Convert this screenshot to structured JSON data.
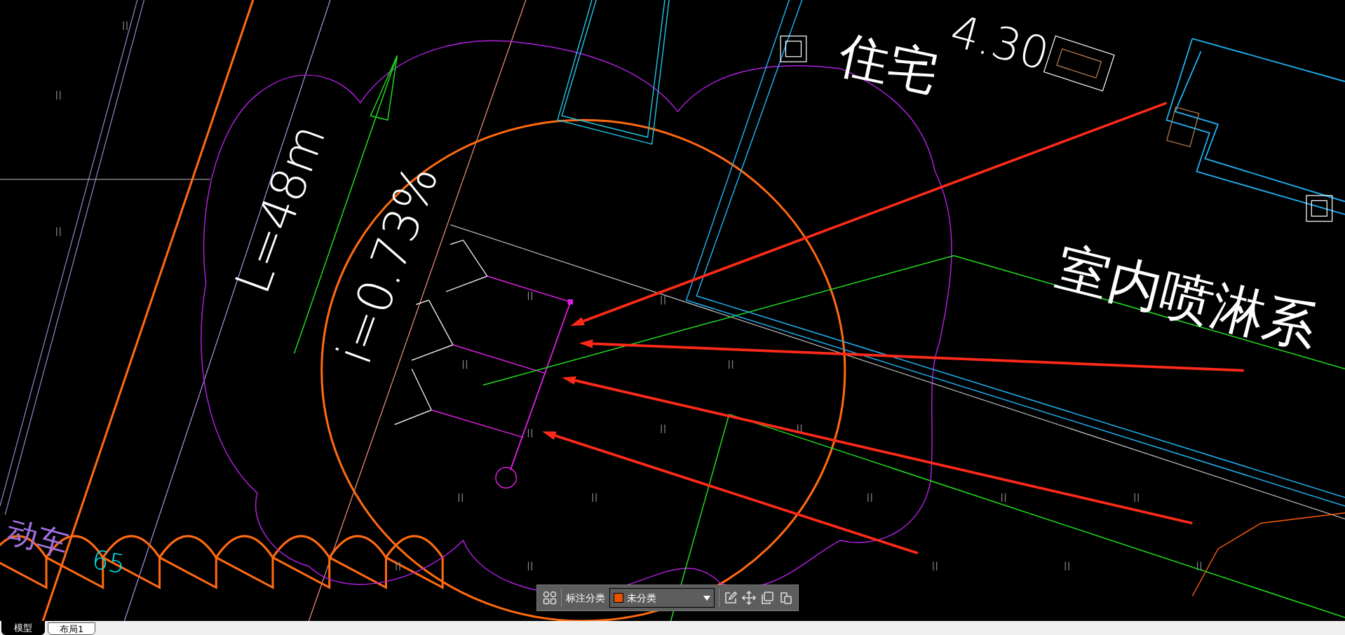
{
  "drawing": {
    "labels": [
      {
        "text": "4.30",
        "color": "#ffffff"
      },
      {
        "text": "住宅",
        "color": "#ffffff"
      },
      {
        "text": "室内喷淋系",
        "color": "#ffffff"
      },
      {
        "text": "L=48m",
        "color": "#ffffff"
      },
      {
        "text": "i=0.73%",
        "color": "#ffffff"
      },
      {
        "text": "动车",
        "color": "#a070e0"
      },
      {
        "text": "65",
        "color": "#00e5ee"
      }
    ]
  },
  "toolbar": {
    "label": "标注分类",
    "category": {
      "text": "未分类",
      "color": "#e65100"
    }
  },
  "tabs": [
    {
      "label": "模型",
      "selected": true
    },
    {
      "label": "布局1",
      "selected": false
    }
  ]
}
